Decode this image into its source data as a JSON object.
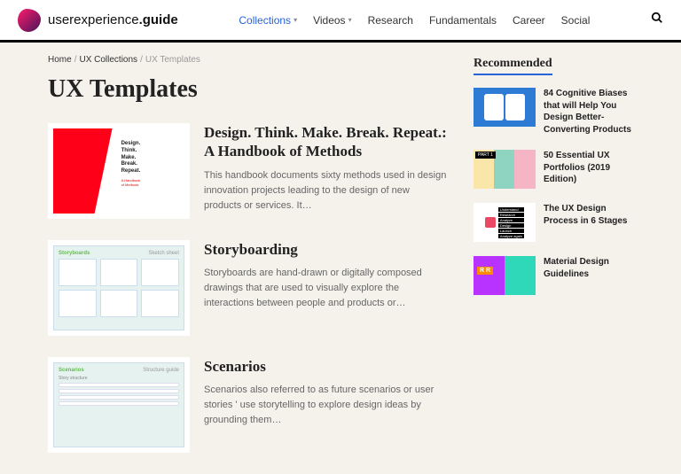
{
  "brand": {
    "part1": "userexperience",
    "part2": ".guide"
  },
  "nav": [
    {
      "label": "Collections",
      "active": true,
      "dropdown": true
    },
    {
      "label": "Videos",
      "active": false,
      "dropdown": true
    },
    {
      "label": "Research",
      "active": false,
      "dropdown": false
    },
    {
      "label": "Fundamentals",
      "active": false,
      "dropdown": false
    },
    {
      "label": "Career",
      "active": false,
      "dropdown": false
    },
    {
      "label": "Social",
      "active": false,
      "dropdown": false
    }
  ],
  "breadcrumbs": {
    "home": "Home",
    "mid": "UX Collections",
    "current": "UX Templates"
  },
  "page_title": "UX Templates",
  "posts": [
    {
      "title": "Design. Think. Make. Break. Repeat.: A Handbook of Methods",
      "desc": "This handbook documents sixty methods used in design innovation projects leading to the design of new products or services. It…",
      "thumb": {
        "lines": "Design.\nThink.\nMake.\nBreak.\nRepeat.",
        "sub": "A Handbook\nof Methods"
      }
    },
    {
      "title": "Storyboarding",
      "desc": "Storyboards are hand-drawn or digitally composed drawings that are used to visually explore the interactions between people and products or…",
      "thumb": {
        "left": "Storyboards",
        "right": "Sketch sheet"
      }
    },
    {
      "title": "Scenarios",
      "desc": "Scenarios also referred to as future scenarios or user stories ' use storytelling to explore design ideas by grounding them…",
      "thumb": {
        "left": "Scenarios",
        "right": "Structure guide"
      }
    }
  ],
  "sidebar": {
    "heading": "Recommended",
    "items": [
      {
        "title": "84 Cognitive Biases that will Help You Design Better-Converting Products"
      },
      {
        "title": "50 Essential UX Portfolios (2019 Edition)"
      },
      {
        "title": "The UX Design Process in 6 Stages",
        "steps": [
          "Understand",
          "Research",
          "Analyze",
          "Design",
          "Launch",
          "Analyze again"
        ]
      },
      {
        "title": "Material Design Guidelines"
      }
    ]
  }
}
